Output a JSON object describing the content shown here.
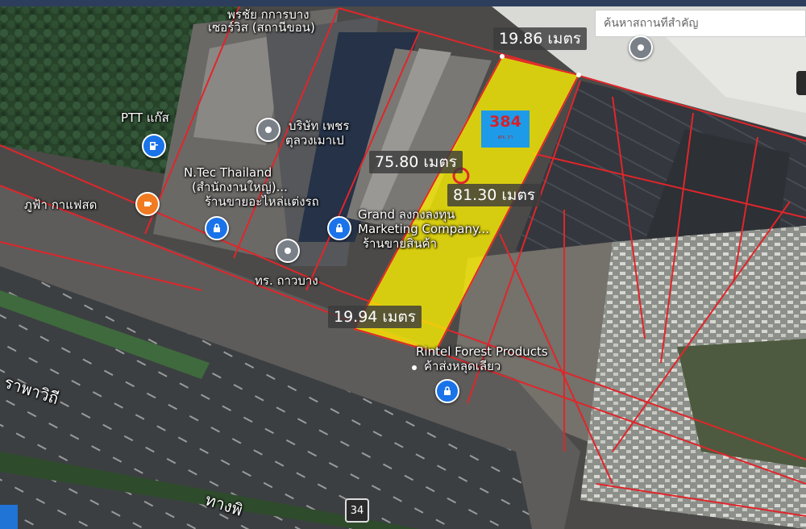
{
  "search": {
    "placeholder": "ค้นหาสถานที่สำคัญ"
  },
  "measurements": {
    "top": "19.86 เมตร",
    "left": "75.80 เมตร",
    "right": "81.30 เมตร",
    "bottom": "19.94 เมตร"
  },
  "lot": {
    "number": "384",
    "sub": "ตร.วา"
  },
  "pois": {
    "top_name_1": "พรชัย กการบาง",
    "top_name_2": "เซอร์วิส (สถานีขอน)",
    "ptt": "PTT แก๊ส",
    "company_1": "บริษัท เพชร",
    "company_2": "ตุลวงเมาเป",
    "ntec_1": "N.Tec Thailand",
    "ntec_2": "(สำนักงานใหญ่)...",
    "ntec_3": "ร้านขายอะไหล่แต่งรถ",
    "cafe": "ภูฟ้า กาแฟสด",
    "grand_1": "Grand ลงกงลงทุน",
    "grand_2": "Marketing Company...",
    "grand_3": "ร้านขายสินค้า",
    "kaarbang": "ทร. ถาวบาง",
    "rintel_1": "Rintel Forest Products",
    "rintel_2": "ค้าส่งหลุดเลียว",
    "road_1": "ราพาวิถี",
    "road_2": "ทางพิ"
  },
  "route": {
    "number": "34"
  },
  "colors": {
    "highlight": "#fff200",
    "boundary": "#e0262b",
    "pin_blue": "#1a73e8",
    "pin_orange": "#f07b20"
  }
}
